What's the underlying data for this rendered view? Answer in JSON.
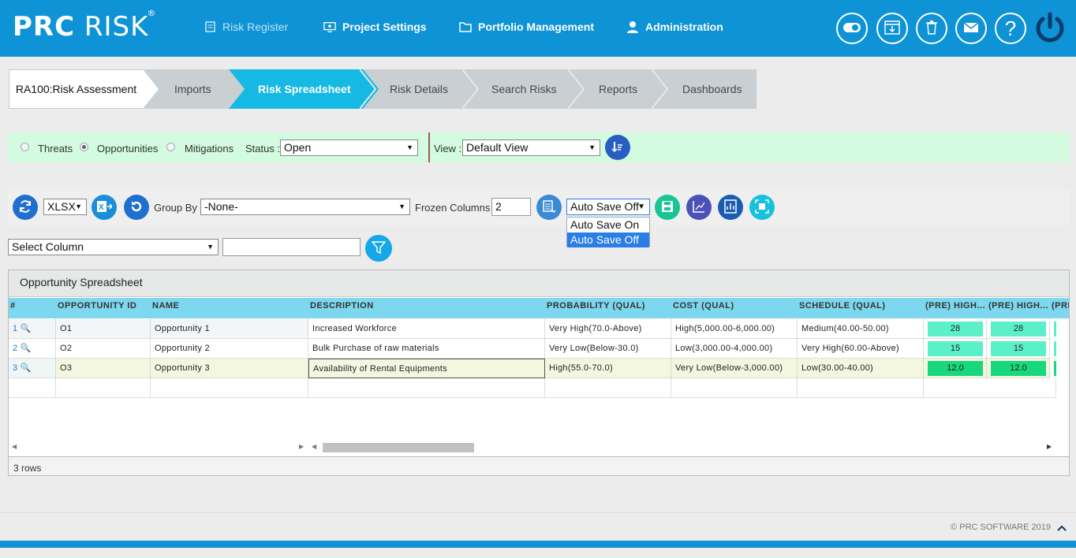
{
  "brand": {
    "logo_bold": "PRC",
    "logo_light": "RISK",
    "reg": "®"
  },
  "nav": [
    {
      "label": "Risk Register"
    },
    {
      "label": "Project Settings"
    },
    {
      "label": "Portfolio Management"
    },
    {
      "label": "Administration"
    }
  ],
  "top_icons": [
    "toggle-icon",
    "download-icon",
    "trash-icon",
    "mail-icon",
    "help-icon",
    "power-icon"
  ],
  "workflow": {
    "current": "RA100:Risk Assessment",
    "steps": [
      "Imports",
      "Risk Spreadsheet",
      "Risk Details",
      "Search Risks",
      "Reports",
      "Dashboards"
    ]
  },
  "filter": {
    "threats": "Threats",
    "opportunities": "Opportunities",
    "mitigations": "Mitigations",
    "status_label": "Status :",
    "status_value": "Open",
    "view_label": "View :",
    "view_value": "Default View"
  },
  "toolbar": {
    "format": "XLSX",
    "group_by_label": "Group By :",
    "group_by_value": "-None-",
    "frozen_label": "Frozen Columns :",
    "frozen_value": "2",
    "autosave_value": "Auto Save Off",
    "autosave_options": [
      "Auto Save On",
      "Auto Save Off"
    ]
  },
  "column_filter": {
    "select_value": "Select Column",
    "text_value": ""
  },
  "grid": {
    "title": "Opportunity Spreadsheet",
    "columns": [
      "#",
      "OPPORTUNITY ID",
      "NAME",
      "DESCRIPTION",
      "PROBABILITY (QUAL)",
      "COST (QUAL)",
      "SCHEDULE (QUAL)",
      "(PRE) HIGH...",
      "(PRE) HIGH...",
      "(PRI"
    ],
    "rows": [
      {
        "num": "1",
        "id": "O1",
        "name": "Opportunity 1",
        "desc": "Increased Workforce",
        "prob": "Very High(70.0-Above)",
        "cost": "High(5,000.00-6,000.00)",
        "sched": "Medium(40.00-50.00)",
        "pre1": "28",
        "pre2": "28"
      },
      {
        "num": "2",
        "id": "O2",
        "name": "Opportunity 2",
        "desc": "Bulk Purchase of raw materials",
        "prob": "Very Low(Below-30.0)",
        "cost": "Low(3,000.00-4,000.00)",
        "sched": "Very High(60.00-Above)",
        "pre1": "15",
        "pre2": "15"
      },
      {
        "num": "3",
        "id": "O3",
        "name": "Opportunity 3",
        "desc": "Availability of Rental Equipments",
        "prob": "High(55.0-70.0)",
        "cost": "Very Low(Below-3,000.00)",
        "sched": "Low(30.00-40.00)",
        "pre1": "12.0",
        "pre2": "12.0"
      }
    ],
    "row_count": "3 rows"
  },
  "footer": {
    "copyright": "© PRC SOFTWARE 2019"
  },
  "colors": {
    "brand_blue": "#0d93d6",
    "accent_cyan": "#16b9e3",
    "header_cyan": "#7dd7ef",
    "filter_green": "#d2fbe0",
    "score_light": "#5cf0c9",
    "score_dark": "#19d87b"
  }
}
